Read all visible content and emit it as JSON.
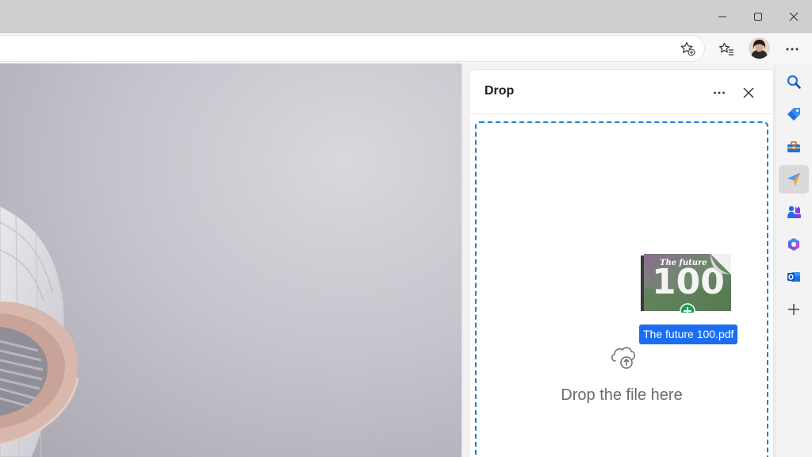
{
  "window": {
    "controls": {
      "minimize": "minimize-icon",
      "maximize": "maximize-icon",
      "close": "close-icon"
    }
  },
  "toolbar": {
    "address_value": "",
    "icons": [
      "add-favorite-icon",
      "favorites-icon",
      "profile-avatar",
      "more-options-icon"
    ]
  },
  "drop_pane": {
    "title": "Drop",
    "more_icon": "more-options-icon",
    "close_icon": "close-icon",
    "dragged_file_name": "The future 100.pdf",
    "thumbnail_title": "The future",
    "thumbnail_number": "100",
    "drop_prompt": "Drop the file here"
  },
  "sidebar": {
    "items": [
      {
        "icon": "search-icon",
        "active": false
      },
      {
        "icon": "shopping-tag-icon",
        "active": false
      },
      {
        "icon": "tools-icon",
        "active": false
      },
      {
        "icon": "drop-send-icon",
        "active": true
      },
      {
        "icon": "games-icon",
        "active": false
      },
      {
        "icon": "office-icon",
        "active": false
      },
      {
        "icon": "outlook-icon",
        "active": false
      },
      {
        "icon": "add-icon",
        "active": false
      }
    ]
  },
  "colors": {
    "accent_blue": "#1b6ef3",
    "dashed_border": "#1a7fd6",
    "add_badge_green": "#16a34a",
    "titlebar": "#cfcfcf"
  }
}
